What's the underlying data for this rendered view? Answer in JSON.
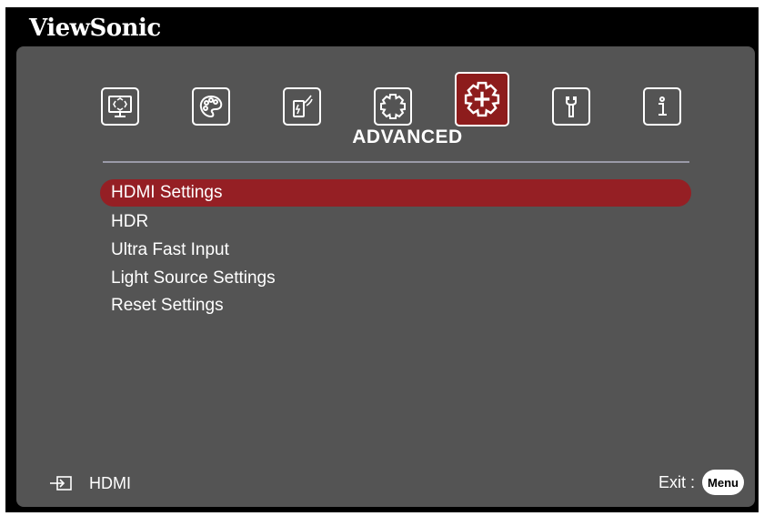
{
  "brand": "ViewSonic",
  "colors": {
    "panel": "#545454",
    "selection": "#951f24",
    "active_tab": "#8d1c1c",
    "text": "#ffffff"
  },
  "tabs": [
    {
      "icon": "display-icon",
      "active": false
    },
    {
      "icon": "palette-icon",
      "active": false
    },
    {
      "icon": "power-management-icon",
      "active": false
    },
    {
      "icon": "gear-icon",
      "active": false
    },
    {
      "icon": "advanced-gear-plus-icon",
      "active": true
    },
    {
      "icon": "wrench-icon",
      "active": false
    },
    {
      "icon": "info-icon",
      "active": false
    }
  ],
  "tab_title": "ADVANCED",
  "menu": {
    "items": [
      {
        "label": "HDMI Settings",
        "selected": true
      },
      {
        "label": "HDR",
        "selected": false
      },
      {
        "label": "Ultra Fast Input",
        "selected": false
      },
      {
        "label": "Light Source Settings",
        "selected": false
      },
      {
        "label": "Reset Settings",
        "selected": false
      }
    ]
  },
  "footer": {
    "source_icon": "input-source-icon",
    "source_label": "HDMI",
    "exit_label": "Exit :",
    "menu_button_label": "Menu"
  }
}
